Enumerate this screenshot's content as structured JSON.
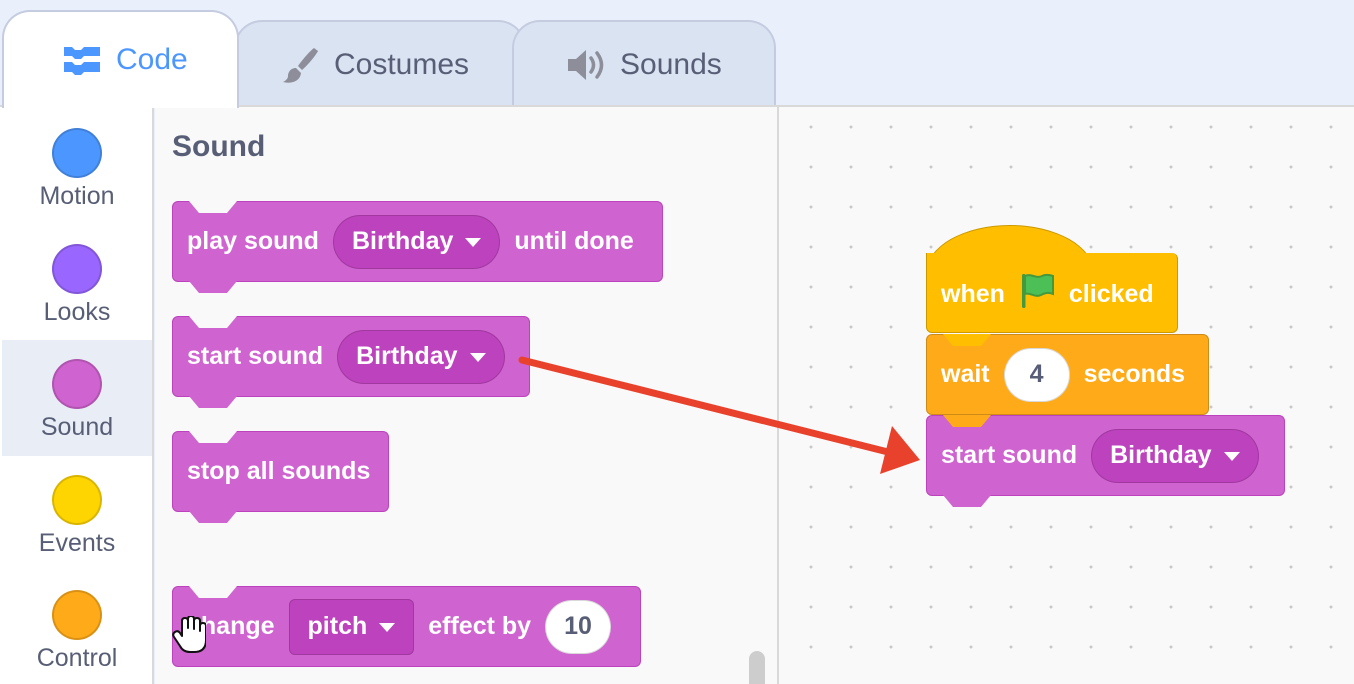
{
  "tabs": {
    "code": "Code",
    "costumes": "Costumes",
    "sounds": "Sounds"
  },
  "categories": [
    {
      "label": "Motion",
      "color": "#4c97ff"
    },
    {
      "label": "Looks",
      "color": "#9966ff"
    },
    {
      "label": "Sound",
      "color": "#cf63cf"
    },
    {
      "label": "Events",
      "color": "#ffd500"
    },
    {
      "label": "Control",
      "color": "#ffab19"
    }
  ],
  "palette": {
    "title": "Sound",
    "play_sound": {
      "pre": "play sound",
      "menu": "Birthday",
      "post": "until done"
    },
    "start_sound": {
      "pre": "start sound",
      "menu": "Birthday"
    },
    "stop_all": "stop all sounds",
    "change_effect": {
      "pre": "change",
      "menu": "pitch",
      "mid": "effect by",
      "value": "10"
    }
  },
  "script": {
    "hat": {
      "pre": "when",
      "icon": "green-flag-icon",
      "post": "clicked"
    },
    "wait": {
      "pre": "wait",
      "value": "4",
      "post": "seconds"
    },
    "start_sound": {
      "pre": "start sound",
      "menu": "Birthday"
    }
  },
  "colors": {
    "sound": "#cf63cf",
    "control": "#ffab19",
    "events": "#ffbf00",
    "accent": "#4c97ff",
    "arrow": "#e8412c"
  }
}
